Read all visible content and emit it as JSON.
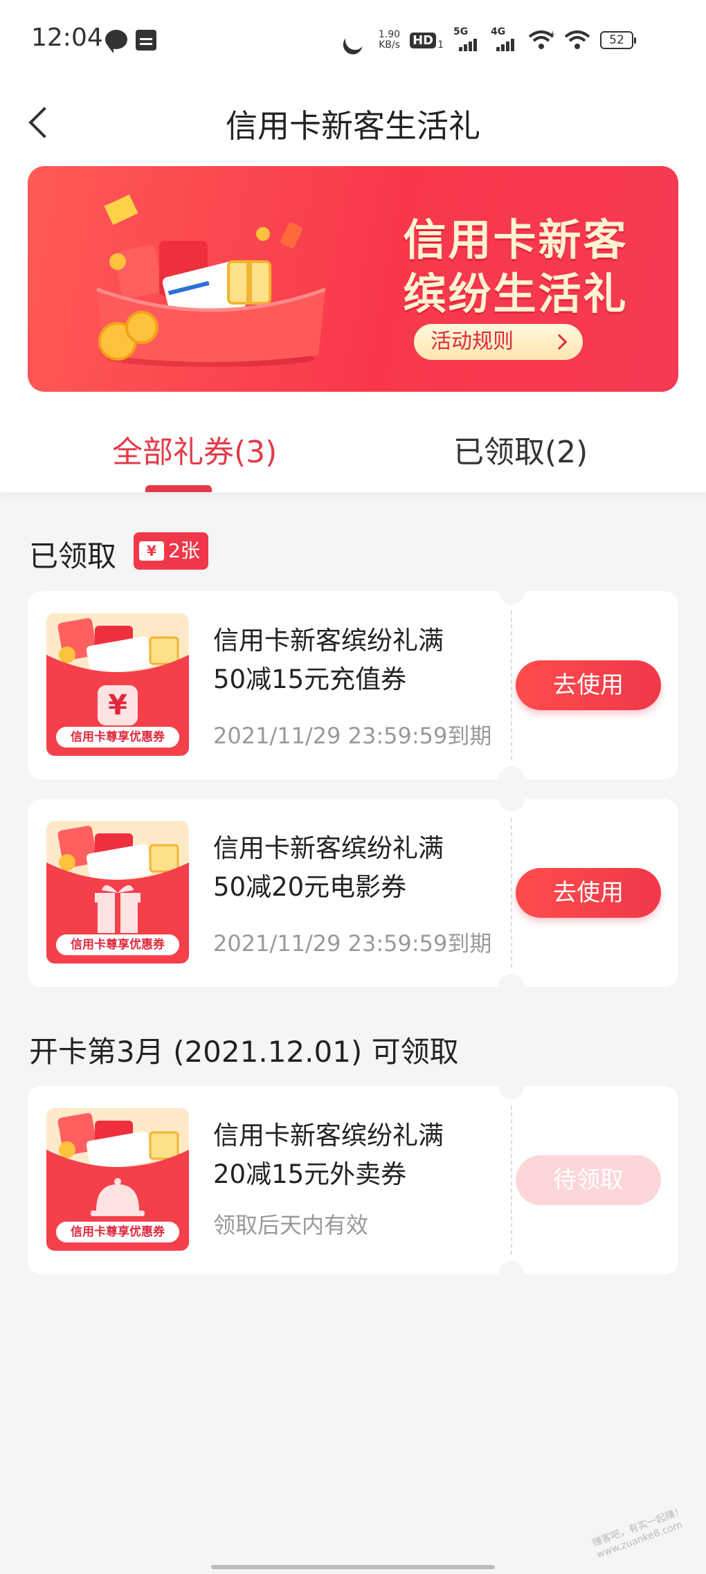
{
  "status_bar": {
    "time": "12:04",
    "speed_value": "1.90",
    "speed_unit": "KB/s",
    "hd_label": "HD",
    "hd_sub": "1",
    "net1_label": "5G",
    "net2_label": "4G",
    "battery": "52",
    "icons": [
      "chat-icon",
      "calendar-icon",
      "moon-icon",
      "hd-icon",
      "signal-5g-icon",
      "signal-4g-icon",
      "wifi-hotspot-icon",
      "wifi-icon",
      "battery-icon"
    ]
  },
  "header": {
    "title": "信用卡新客生活礼",
    "back_icon": "chevron-left-icon"
  },
  "banner": {
    "title_line1": "信用卡新客",
    "title_line2": "缤纷生活礼",
    "rules_label": "活动规则",
    "colors": {
      "start": "#ff5a56",
      "end": "#f53a52",
      "text": "#fff3d3"
    }
  },
  "tabs": [
    {
      "label": "全部礼券(3)",
      "active": true
    },
    {
      "label": "已领取(2)",
      "active": false
    }
  ],
  "sections": {
    "claimed_title": "已领取",
    "claimed_count": "2张",
    "ticket_symbol": "¥",
    "pending_title": "开卡第3月 (2021.12.01) 可领取"
  },
  "coupons": [
    {
      "title_line1": "信用卡新客缤纷礼满",
      "title_line2": "50减15元充值券",
      "subtitle": "2021/11/29 23:59:59到期",
      "button": "去使用",
      "thumb_caption": "信用卡尊享优惠券",
      "thumb_icon": "yuan-icon",
      "thumb_symbol": "¥"
    },
    {
      "title_line1": "信用卡新客缤纷礼满",
      "title_line2": "50减20元电影券",
      "subtitle": "2021/11/29 23:59:59到期",
      "button": "去使用",
      "thumb_caption": "信用卡尊享优惠券",
      "thumb_icon": "gift-icon"
    },
    {
      "title_line1": "信用卡新客缤纷礼满",
      "title_line2": "20减15元外卖券",
      "subtitle": "领取后天内有效",
      "button": "待领取",
      "thumb_caption": "信用卡尊享优惠券",
      "thumb_icon": "cloche-icon"
    }
  ],
  "accent_color": "#e33a48",
  "watermark_line1": "赚客吧，有实一起赚！",
  "watermark_line2": "www.zuanke8.com"
}
